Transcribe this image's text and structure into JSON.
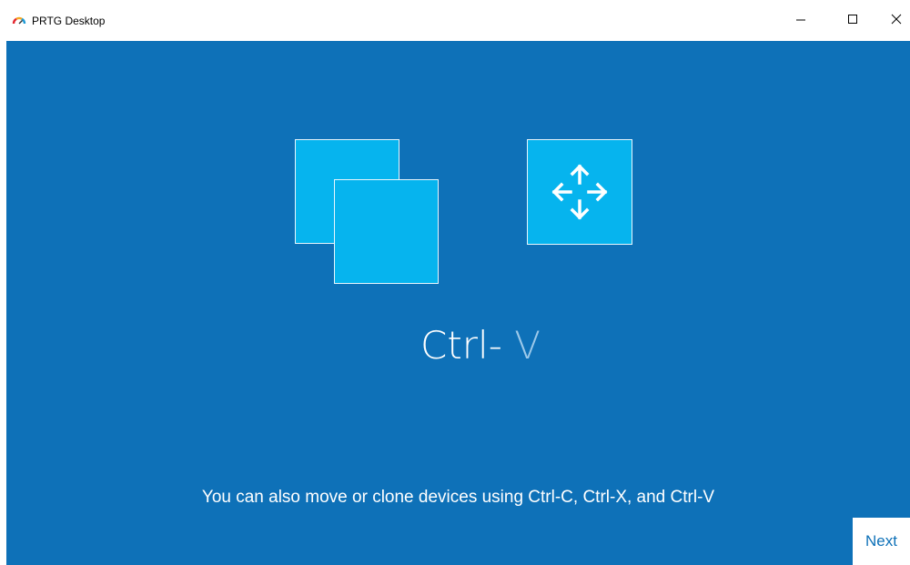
{
  "window": {
    "title": "PRTG Desktop",
    "icon": "prtg-gauge-icon",
    "controls": {
      "minimize": "minimize-icon",
      "maximize": "maximize-icon",
      "close": "close-icon"
    }
  },
  "slide": {
    "illustration": {
      "left": "copy-squares-icon",
      "right": "move-arrows-icon"
    },
    "hotkey_prefix": "Ctrl-",
    "hotkey_key": "V",
    "caption": "You can also move or clone devices using Ctrl-C, Ctrl-X, and Ctrl-V"
  },
  "buttons": {
    "next_label": "Next"
  },
  "colors": {
    "background": "#0e71b8",
    "tile": "#06b4ee",
    "tile_border": "#e8f6fd",
    "hotkey_key": "#9cc9ea"
  }
}
